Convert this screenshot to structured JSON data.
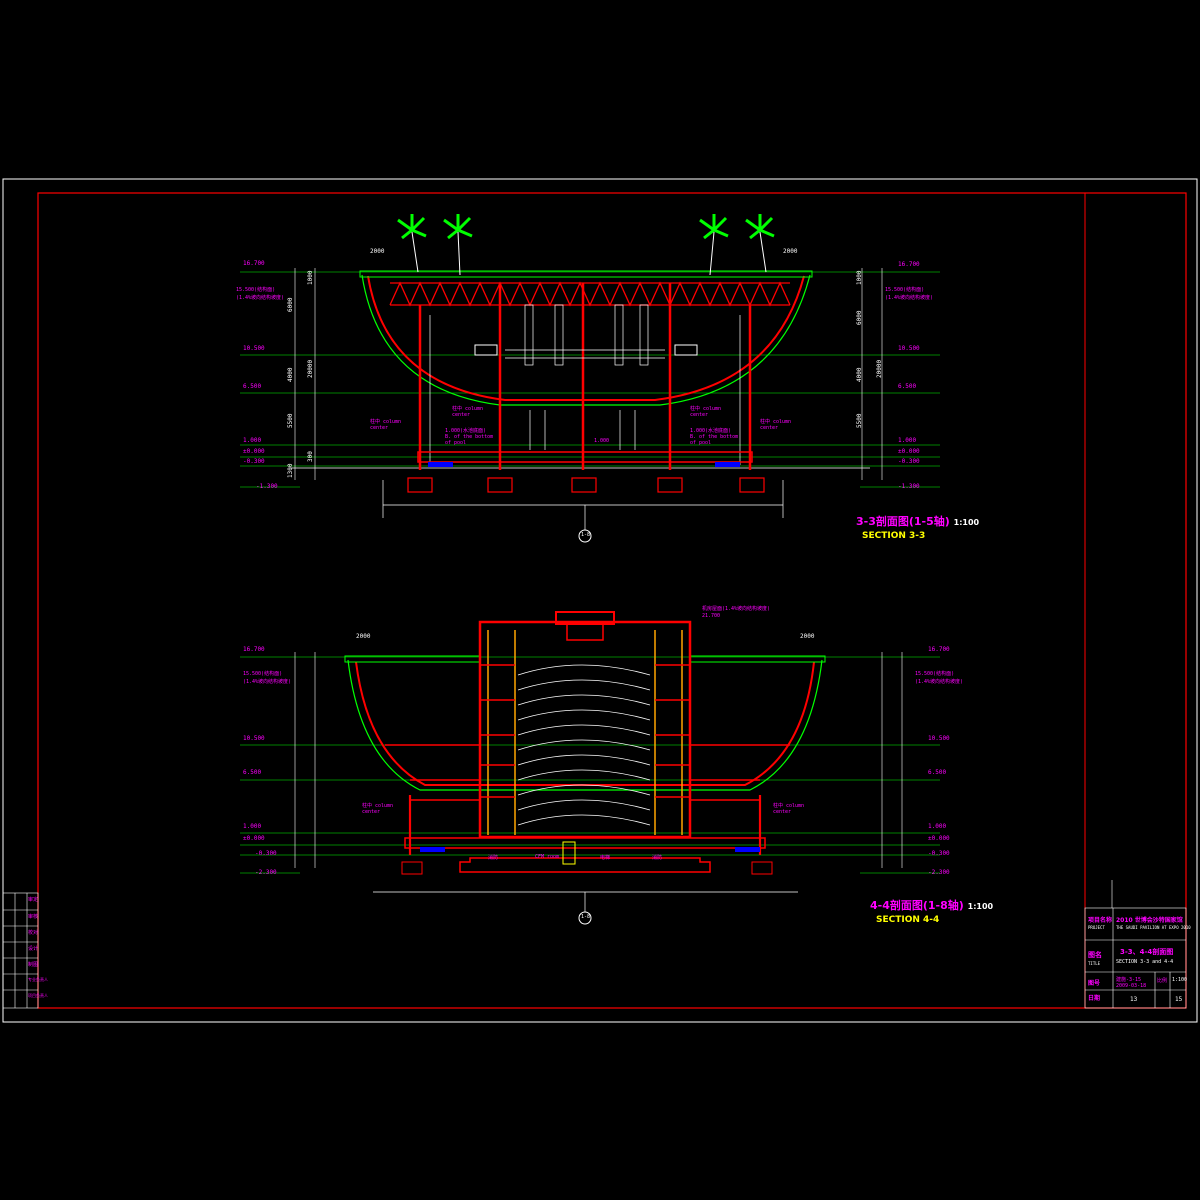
{
  "section_33": {
    "title_cn": "3-3剖面图",
    "axis_tag": "1-5轴",
    "scale": "1:100",
    "title_en": "SECTION 3-3",
    "dim_left_top": "2000",
    "dim_right_top": "2000",
    "dim_span": "4000",
    "left_levels": [
      "16.700",
      "15.500(结构面)",
      "(1.4%坡向结构坡度)",
      "10.500",
      "6.500",
      "1.000",
      "±0.000",
      "-0.300",
      "-1.300"
    ],
    "right_levels": [
      "16.700",
      "15.500(结构面)",
      "(1.4%坡向结构坡度)",
      "10.500",
      "6.500",
      "1.000",
      "±0.000",
      "-0.300",
      "-1.300"
    ],
    "v_dims_left": [
      "6000",
      "4000",
      "5500",
      "1300",
      "300",
      "20000",
      "1000"
    ],
    "v_dims_right": [
      "6000",
      "4000",
      "5500",
      "20000",
      "1000"
    ],
    "notes": [
      "柱中 column center",
      "柱中 column center",
      "柱中 column center",
      "柱中 column center",
      "1.000(水池底面) B. of the bottom of pool",
      "1.000(水池底面) B. of the bottom of pool",
      "1.000"
    ],
    "axis_bubble": "1-8"
  },
  "section_44": {
    "title_cn": "4-4剖面图",
    "axis_tag": "1-8轴",
    "scale": "1:100",
    "title_en": "SECTION 4-4",
    "dim_left_top": "2000",
    "dim_right_top": "2000",
    "top_note": "机房屋面(1.4%坡向结构坡度)",
    "top_note2": "21.700",
    "left_levels": [
      "16.700",
      "15.500(结构面)",
      "(1.4%坡向结构坡度)",
      "10.500",
      "6.500",
      "1.000",
      "±0.000",
      "-0.300",
      "-2.300"
    ],
    "right_levels": [
      "16.700",
      "15.500(结构面)",
      "(1.4%坡向结构坡度)",
      "10.500",
      "6.500",
      "1.000",
      "±0.000",
      "-0.300",
      "-2.300"
    ],
    "notes": [
      "柱中 column center",
      "柱中 column center"
    ],
    "room_labels": [
      "消防",
      "CFM room",
      "电梯",
      "消防"
    ],
    "axis_bubble": "1-8"
  },
  "title_block": {
    "project_label": "项目名称",
    "project_label_en": "PROJECT",
    "project_name": "2010 世博会沙特国家馆",
    "project_name_en": "THE SAUDI PAVILION AT EXPO 2010",
    "drawing_label": "图名",
    "drawing_label_en": "TITLE",
    "drawing_name": "3-3、4-4剖面图",
    "drawing_name_en": "SECTION 3-3 and 4-4",
    "sheet_no_label": "图号",
    "sheet_no": "建施-3-15",
    "date_label": "日期",
    "date": "2009-03-18",
    "scale_label": "比例",
    "scale": "1:100",
    "page": "13",
    "total": "15"
  },
  "stamp_block": {
    "rows": [
      "审定",
      "审核",
      "校对",
      "设计",
      "制图",
      "专业负责人",
      "项目负责人"
    ]
  },
  "colors": {
    "background": "#000000",
    "frame": "#ffffff",
    "border_red": "#ff0000",
    "structure_red": "#ff0000",
    "slab_green": "#00ff00",
    "annotation_magenta": "#ff00ff",
    "title_yellow": "#ffff00",
    "text_cyan": "#00ffff",
    "palm_green": "#00ff00",
    "line_white": "#ffffff",
    "wall_orange": "#ffa500",
    "pool_blue": "#0000ff"
  }
}
